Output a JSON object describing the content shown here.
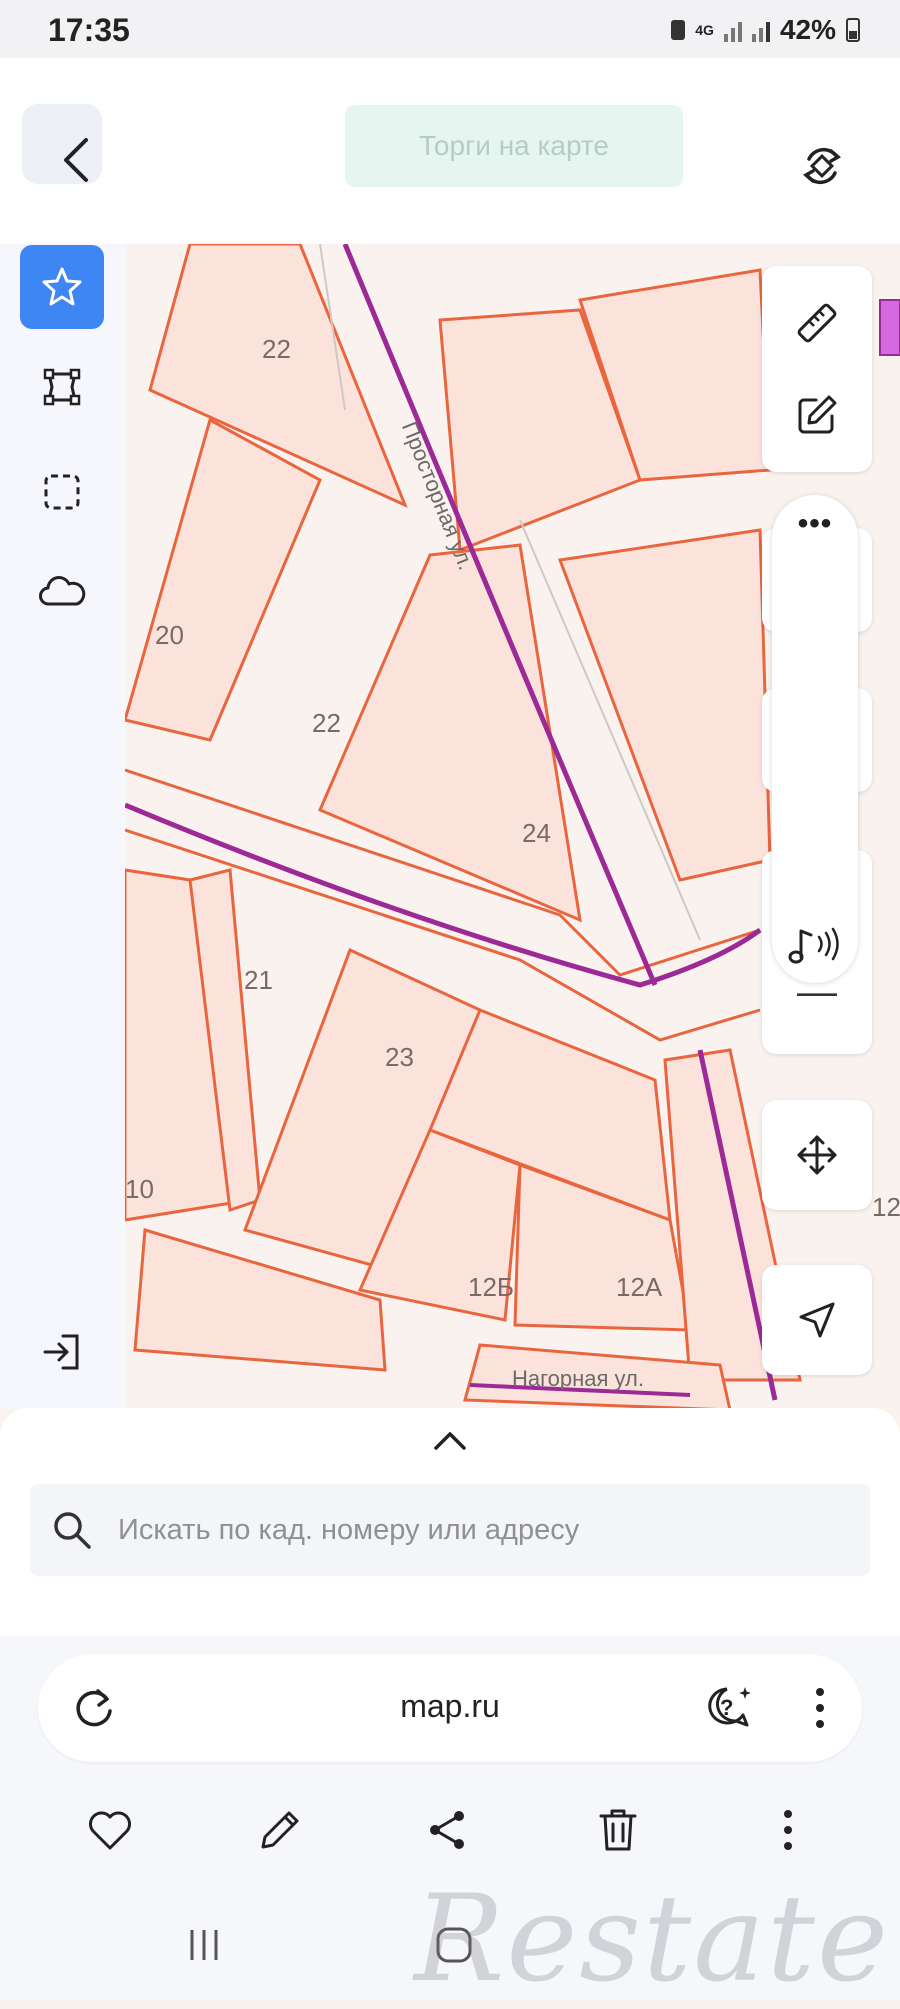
{
  "status_bar": {
    "time": "17:35",
    "network": "4G",
    "battery": "42%"
  },
  "header": {
    "auction_button_label": "Торги на карте"
  },
  "map": {
    "plot_numbers": [
      "22",
      "20",
      "22",
      "24",
      "21",
      "23",
      "10",
      "12Б",
      "12А",
      "12"
    ],
    "streets": [
      "Просторная ул.",
      "Нагорная ул."
    ]
  },
  "zoom": {
    "zoom_out_label": "—"
  },
  "more_panel": {
    "dots": "•••"
  },
  "search": {
    "placeholder": "Искать по кад. номеру или адресу"
  },
  "browser": {
    "url": "map.ru"
  },
  "watermark": "Restate",
  "icons": {
    "back": "chevron-left-icon",
    "rotate": "rotate-icon",
    "favorite": "star-icon",
    "polygon": "polygon-icon",
    "selection": "dashed-square-icon",
    "cloud": "cloud-icon",
    "login": "login-icon",
    "ruler": "ruler-icon",
    "edit": "edit-icon",
    "sound": "music-note-icon",
    "pan": "move-icon",
    "locate": "navigation-arrow-icon",
    "search": "search-icon",
    "reload": "reload-icon",
    "assistant": "chat-question-icon",
    "heart": "heart-icon",
    "pencil": "pencil-icon",
    "share": "share-icon",
    "trash": "trash-icon",
    "menu": "kebab-menu-icon"
  },
  "colors": {
    "accent": "#3f86f5",
    "parcel_border": "#e9653e",
    "boundary": "#9b2a96",
    "map_fill": "#fbe3dc"
  }
}
